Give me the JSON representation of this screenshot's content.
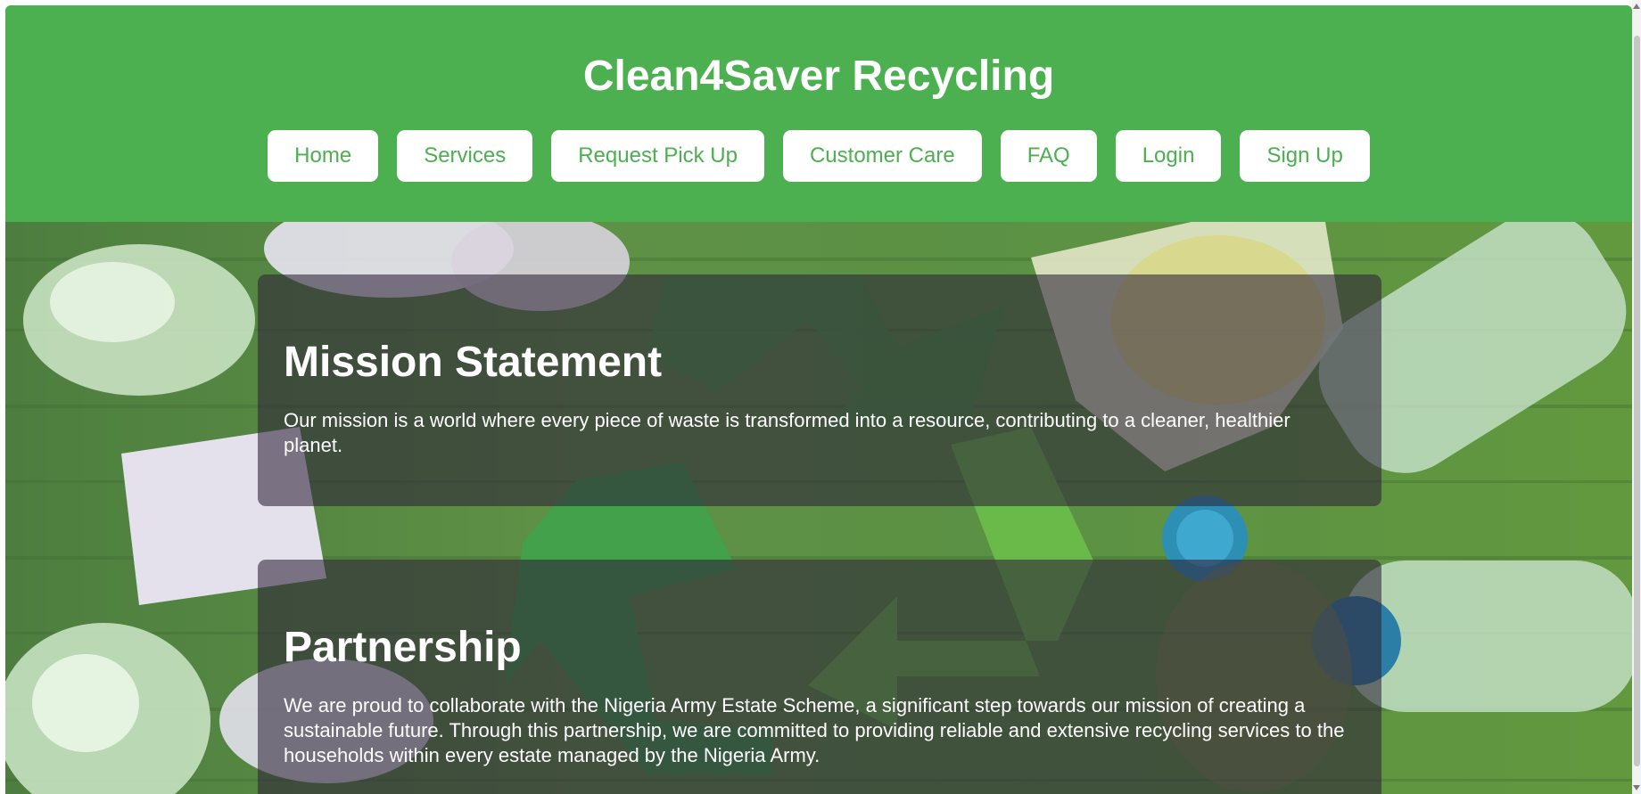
{
  "header": {
    "title": "Clean4Saver Recycling",
    "background_color": "#4caf50",
    "nav": [
      {
        "label": "Home"
      },
      {
        "label": "Services"
      },
      {
        "label": "Request Pick Up"
      },
      {
        "label": "Customer Care"
      },
      {
        "label": "FAQ"
      },
      {
        "label": "Login"
      },
      {
        "label": "Sign Up"
      }
    ],
    "nav_text_color": "#4caf50"
  },
  "hero": {
    "background_image_icon": "recycling-symbol-icon"
  },
  "sections": {
    "mission": {
      "heading": "Mission Statement",
      "text": "Our mission is a world where every piece of waste is transformed into a resource, contributing to a cleaner, healthier planet."
    },
    "partnership": {
      "heading": "Partnership",
      "text": "We are proud to collaborate with the Nigeria Army Estate Scheme, a significant step towards our mission of creating a sustainable future. Through this partnership, we are committed to providing reliable and extensive recycling services to the households within every estate managed by the Nigeria Army."
    }
  }
}
